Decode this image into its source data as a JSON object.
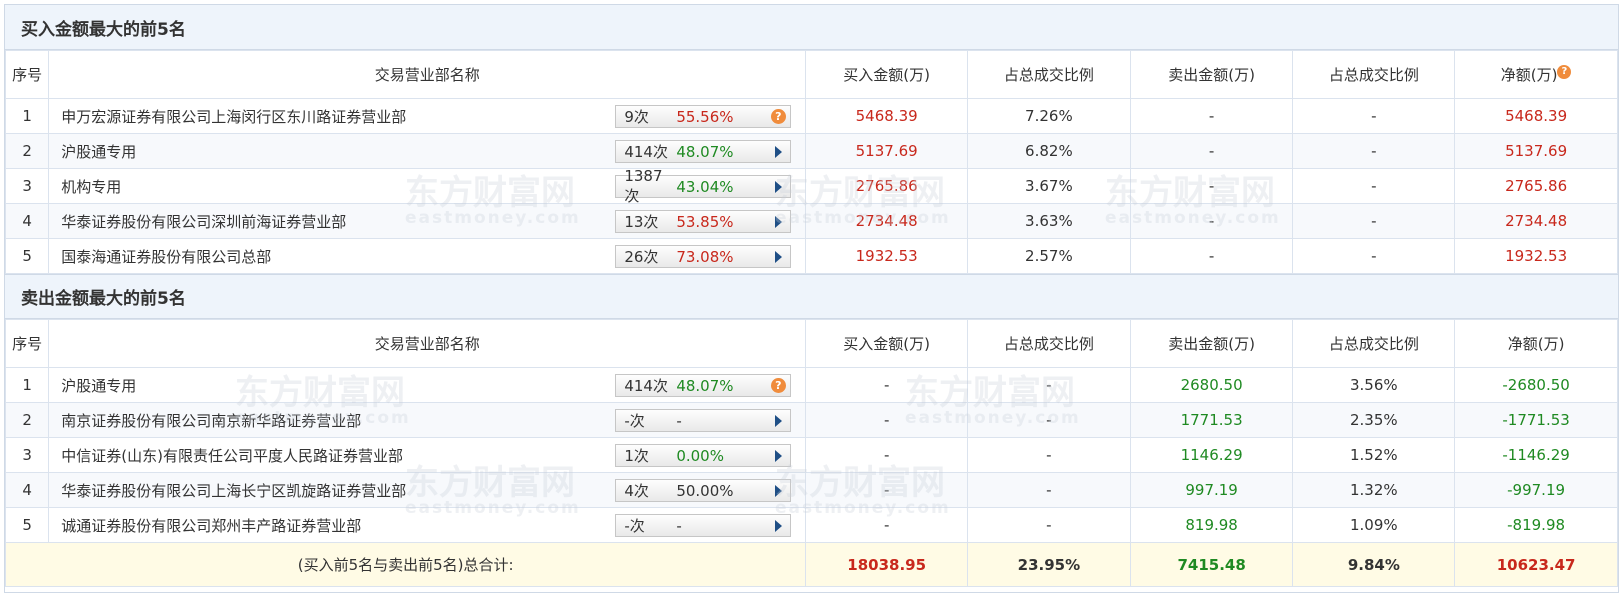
{
  "buy_section": {
    "title": "买入金额最大的前5名",
    "headers": {
      "seq": "序号",
      "name": "交易营业部名称",
      "buy": "买入金额(万)",
      "buy_ratio": "占总成交比例",
      "sell": "卖出金额(万)",
      "sell_ratio": "占总成交比例",
      "net": "净额(万)"
    },
    "rows": [
      {
        "seq": "1",
        "name": "申万宏源证券有限公司上海闵行区东川路证券营业部",
        "count": "9次",
        "pct": "55.56%",
        "pct_color": "red",
        "icon": "question-icon",
        "buy": "5468.39",
        "buy_ratio": "7.26%",
        "sell": "-",
        "sell_ratio": "-",
        "net": "5468.39"
      },
      {
        "seq": "2",
        "name": "沪股通专用",
        "count": "414次",
        "pct": "48.07%",
        "pct_color": "green",
        "icon": "arrow-right-icon",
        "buy": "5137.69",
        "buy_ratio": "6.82%",
        "sell": "-",
        "sell_ratio": "-",
        "net": "5137.69"
      },
      {
        "seq": "3",
        "name": "机构专用",
        "count": "1387次",
        "pct": "43.04%",
        "pct_color": "green",
        "icon": "arrow-right-icon",
        "buy": "2765.86",
        "buy_ratio": "3.67%",
        "sell": "-",
        "sell_ratio": "-",
        "net": "2765.86"
      },
      {
        "seq": "4",
        "name": "华泰证券股份有限公司深圳前海证券营业部",
        "count": "13次",
        "pct": "53.85%",
        "pct_color": "red",
        "icon": "arrow-right-icon",
        "buy": "2734.48",
        "buy_ratio": "3.63%",
        "sell": "-",
        "sell_ratio": "-",
        "net": "2734.48"
      },
      {
        "seq": "5",
        "name": "国泰海通证券股份有限公司总部",
        "count": "26次",
        "pct": "73.08%",
        "pct_color": "red",
        "icon": "arrow-right-icon",
        "buy": "1932.53",
        "buy_ratio": "2.57%",
        "sell": "-",
        "sell_ratio": "-",
        "net": "1932.53"
      }
    ]
  },
  "sell_section": {
    "title": "卖出金额最大的前5名",
    "headers": {
      "seq": "序号",
      "name": "交易营业部名称",
      "buy": "买入金额(万)",
      "buy_ratio": "占总成交比例",
      "sell": "卖出金额(万)",
      "sell_ratio": "占总成交比例",
      "net": "净额(万)"
    },
    "rows": [
      {
        "seq": "1",
        "name": "沪股通专用",
        "count": "414次",
        "pct": "48.07%",
        "pct_color": "green",
        "icon": "question-icon",
        "buy": "-",
        "buy_ratio": "-",
        "sell": "2680.50",
        "sell_ratio": "3.56%",
        "net": "-2680.50"
      },
      {
        "seq": "2",
        "name": "南京证券股份有限公司南京新华路证券营业部",
        "count": "-次",
        "pct": "-",
        "pct_color": "plain",
        "icon": "arrow-right-icon",
        "buy": "-",
        "buy_ratio": "-",
        "sell": "1771.53",
        "sell_ratio": "2.35%",
        "net": "-1771.53"
      },
      {
        "seq": "3",
        "name": "中信证券(山东)有限责任公司平度人民路证券营业部",
        "count": "1次",
        "pct": "0.00%",
        "pct_color": "green",
        "icon": "arrow-right-icon",
        "buy": "-",
        "buy_ratio": "-",
        "sell": "1146.29",
        "sell_ratio": "1.52%",
        "net": "-1146.29"
      },
      {
        "seq": "4",
        "name": "华泰证券股份有限公司上海长宁区凯旋路证券营业部",
        "count": "4次",
        "pct": "50.00%",
        "pct_color": "plain",
        "icon": "arrow-right-icon",
        "buy": "-",
        "buy_ratio": "-",
        "sell": "997.19",
        "sell_ratio": "1.32%",
        "net": "-997.19"
      },
      {
        "seq": "5",
        "name": "诚通证券股份有限公司郑州丰产路证券营业部",
        "count": "-次",
        "pct": "-",
        "pct_color": "plain",
        "icon": "arrow-right-icon",
        "buy": "-",
        "buy_ratio": "-",
        "sell": "819.98",
        "sell_ratio": "1.09%",
        "net": "-819.98"
      }
    ]
  },
  "total": {
    "label": "(买入前5名与卖出前5名)总合计:",
    "buy": "18038.95",
    "buy_ratio": "23.95%",
    "sell": "7415.48",
    "sell_ratio": "9.84%",
    "net": "10623.47"
  },
  "watermark": {
    "title": "东方财富网",
    "sub": "eastmoney.com"
  },
  "colors": {
    "red": "#c8281c",
    "green": "#1f8a22",
    "header_bg": "#eef4fb",
    "total_bg": "#fffbe5",
    "icon_orange": "#f08c3c"
  }
}
